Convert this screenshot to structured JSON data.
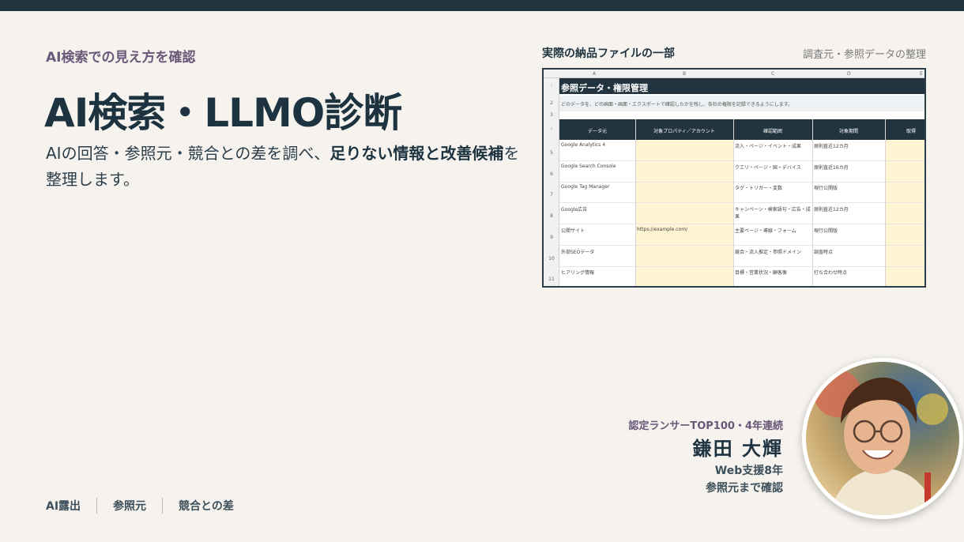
{
  "hero": {
    "eyebrow": "AI検索での見え方を確認",
    "headline": "AI検索・LLMO診断",
    "lead_part1": "AIの回答・参照元・競合との差を調べ、",
    "lead_bold1": "足りない情報と改善候補",
    "lead_part2": "を整理します。"
  },
  "sheet_preview": {
    "title": "実際の納品ファイルの一部",
    "caption": "調査元・参照データの整理",
    "columns": [
      "A",
      "B",
      "C",
      "D",
      "E"
    ],
    "sheet_title": "参照データ・権限管理",
    "note": "どのデータを、どの画面・画面・エクスポートで確認したかを残し、各社の権限を記録できるようにします。",
    "headers": [
      "データ元",
      "対象プロパティ／アカウント",
      "確認範囲",
      "対象期間",
      "取得"
    ],
    "rows": [
      {
        "num": "5",
        "source": "Google Analytics 4",
        "property": "",
        "scope": "流入・ページ・イベント・成果",
        "period": "原則直近12カ月"
      },
      {
        "num": "6",
        "source": "Google Search Console",
        "property": "",
        "scope": "クエリ・ページ・国・デバイス",
        "period": "原則直近16カ月"
      },
      {
        "num": "7",
        "source": "Google Tag Manager",
        "property": "",
        "scope": "タグ・トリガー・変数",
        "period": "現行公開版"
      },
      {
        "num": "8",
        "source": "Google広告",
        "property": "",
        "scope": "キャンペーン・検索語句・広告・成果",
        "period": "原則直近12カ月"
      },
      {
        "num": "9",
        "source": "公開サイト",
        "property": "https://example.com/",
        "scope": "主要ページ・導線・フォーム",
        "period": "現行公開版"
      },
      {
        "num": "10",
        "source": "外部SEOデータ",
        "property": "",
        "scope": "競合・流入推定・参照ドメイン",
        "period": "調査時点"
      },
      {
        "num": "11",
        "source": "ヒアリング情報",
        "property": "",
        "scope": "目標・営業状況・顧客像",
        "period": "打ち合わせ時点"
      }
    ],
    "row_numbers": [
      "1",
      "2",
      "3",
      "4"
    ]
  },
  "profile": {
    "tagline": "認定ランサーTOP100・4年連続",
    "name": "鎌田 大輝",
    "years": "Web支援8年",
    "detail": "参照元まで確認"
  },
  "footer": {
    "tags": [
      "AI露出",
      "参照元",
      "競合との差"
    ]
  },
  "colors": {
    "navy": "#223440",
    "accent_purple": "#6a5878",
    "background": "#f6f3ef",
    "sheet_highlight": "#fff5d2"
  }
}
